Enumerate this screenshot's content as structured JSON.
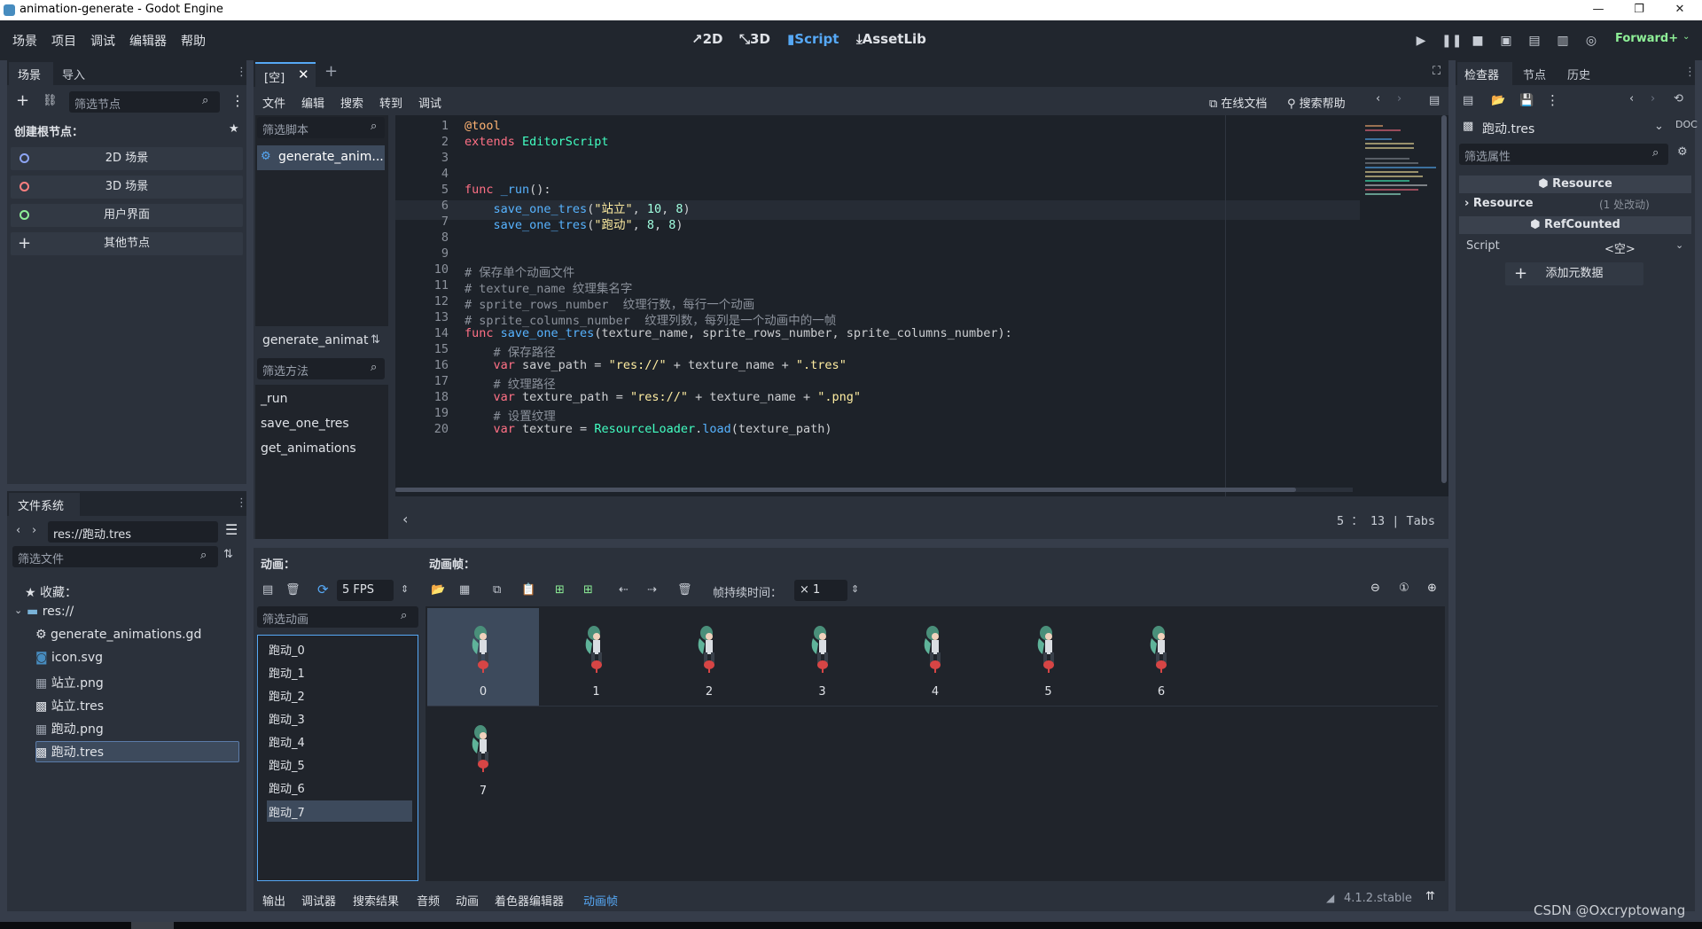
{
  "window": {
    "title": "animation-generate - Godot Engine",
    "minimize": "—",
    "restore": "❐",
    "close": "✕"
  },
  "menubar": {
    "items": [
      "场景",
      "项目",
      "调试",
      "编辑器",
      "帮助"
    ],
    "workspaces": [
      {
        "label": "2D",
        "icon": "↗"
      },
      {
        "label": "3D",
        "icon": "⤡"
      },
      {
        "label": "Script",
        "icon": "▮"
      },
      {
        "label": "AssetLib",
        "icon": "⤓"
      }
    ],
    "renderer": "Forward+"
  },
  "scene_dock": {
    "tabs": [
      "场景",
      "导入"
    ],
    "filter_placeholder": "筛选节点",
    "create_root_label": "创建根节点：",
    "root_buttons": [
      {
        "label": "2D 场景",
        "color": "#8da5f3"
      },
      {
        "label": "3D 场景",
        "color": "#fc7f7f"
      },
      {
        "label": "用户界面",
        "color": "#8eef97"
      },
      {
        "label": "其他节点",
        "color": "#e0e0e0"
      }
    ]
  },
  "filesystem": {
    "tab": "文件系统",
    "path": "res://跑动.tres",
    "filter_placeholder": "筛选文件",
    "favorites": "收藏：",
    "items": [
      {
        "label": "res://",
        "icon": "folder"
      },
      {
        "label": "generate_animations.gd",
        "icon": "gear"
      },
      {
        "label": "icon.svg",
        "icon": "image"
      },
      {
        "label": "站立.png",
        "icon": "image"
      },
      {
        "label": "站立.tres",
        "icon": "resource"
      },
      {
        "label": "跑动.png",
        "icon": "image"
      },
      {
        "label": "跑动.tres",
        "icon": "resource"
      }
    ]
  },
  "script_editor": {
    "tab": "[空]",
    "menu": [
      "文件",
      "编辑",
      "搜索",
      "转到",
      "调试"
    ],
    "online_docs": "在线文档",
    "search_help": "搜索帮助",
    "filter_scripts": "筛选脚本",
    "script_item": "generate_anim...",
    "methods_header": "generate_animat",
    "filter_methods": "筛选方法",
    "methods": [
      "_run",
      "save_one_tres",
      "get_animations"
    ],
    "status": "5 ：  13 | Tabs",
    "lines": [
      [
        {
          "c": "an",
          "t": "@tool"
        }
      ],
      [
        {
          "c": "kw",
          "t": "extends "
        },
        {
          "c": "ty",
          "t": "EditorScript"
        }
      ],
      [],
      [],
      [
        {
          "c": "kw",
          "t": "func "
        },
        {
          "c": "fn",
          "t": "_run"
        },
        {
          "c": "tx",
          "t": "():"
        }
      ],
      [
        {
          "c": "tx",
          "t": "    "
        },
        {
          "c": "fn",
          "t": "save_one_tres"
        },
        {
          "c": "tx",
          "t": "("
        },
        {
          "c": "st",
          "t": "\"站立\""
        },
        {
          "c": "tx",
          "t": ", "
        },
        {
          "c": "nm",
          "t": "10"
        },
        {
          "c": "tx",
          "t": ", "
        },
        {
          "c": "nm",
          "t": "8"
        },
        {
          "c": "tx",
          "t": ")"
        }
      ],
      [
        {
          "c": "tx",
          "t": "    "
        },
        {
          "c": "fn",
          "t": "save_one_tres"
        },
        {
          "c": "tx",
          "t": "("
        },
        {
          "c": "st",
          "t": "\"跑动\""
        },
        {
          "c": "tx",
          "t": ", "
        },
        {
          "c": "nm",
          "t": "8"
        },
        {
          "c": "tx",
          "t": ", "
        },
        {
          "c": "nm",
          "t": "8"
        },
        {
          "c": "tx",
          "t": ")"
        }
      ],
      [],
      [],
      [
        {
          "c": "cm",
          "t": "# 保存单个动画文件"
        }
      ],
      [
        {
          "c": "cm",
          "t": "# texture_name 纹理集名字"
        }
      ],
      [
        {
          "c": "cm",
          "t": "# sprite_rows_number  纹理行数，每行一个动画"
        }
      ],
      [
        {
          "c": "cm",
          "t": "# sprite_columns_number  纹理列数，每列是一个动画中的一帧"
        }
      ],
      [
        {
          "c": "kw",
          "t": "func "
        },
        {
          "c": "fn",
          "t": "save_one_tres"
        },
        {
          "c": "tx",
          "t": "(texture_name, sprite_rows_number, sprite_columns_number):"
        }
      ],
      [
        {
          "c": "tx",
          "t": "    "
        },
        {
          "c": "cm",
          "t": "# 保存路径"
        }
      ],
      [
        {
          "c": "tx",
          "t": "    "
        },
        {
          "c": "kw",
          "t": "var "
        },
        {
          "c": "tx",
          "t": "save_path = "
        },
        {
          "c": "st",
          "t": "\"res://\""
        },
        {
          "c": "tx",
          "t": " + texture_name + "
        },
        {
          "c": "st",
          "t": "\".tres\""
        }
      ],
      [
        {
          "c": "tx",
          "t": "    "
        },
        {
          "c": "cm",
          "t": "# 纹理路径"
        }
      ],
      [
        {
          "c": "tx",
          "t": "    "
        },
        {
          "c": "kw",
          "t": "var "
        },
        {
          "c": "tx",
          "t": "texture_path = "
        },
        {
          "c": "st",
          "t": "\"res://\""
        },
        {
          "c": "tx",
          "t": " + texture_name + "
        },
        {
          "c": "st",
          "t": "\".png\""
        }
      ],
      [
        {
          "c": "tx",
          "t": "    "
        },
        {
          "c": "cm",
          "t": "# 设置纹理"
        }
      ],
      [
        {
          "c": "tx",
          "t": "    "
        },
        {
          "c": "kw",
          "t": "var "
        },
        {
          "c": "tx",
          "t": "texture = "
        },
        {
          "c": "ty",
          "t": "ResourceLoader"
        },
        {
          "c": "tx",
          "t": "."
        },
        {
          "c": "fn",
          "t": "load"
        },
        {
          "c": "tx",
          "t": "(texture_path)"
        }
      ]
    ]
  },
  "anim_panel": {
    "animations_label": "动画：",
    "frames_label": "动画帧：",
    "fps": "5 FPS",
    "frame_duration_label": "帧持续时间：",
    "frame_duration": "× 1",
    "filter_animations": "筛选动画",
    "animations": [
      "跑动_0",
      "跑动_1",
      "跑动_2",
      "跑动_3",
      "跑动_4",
      "跑动_5",
      "跑动_6",
      "跑动_7"
    ],
    "frames": [
      "0",
      "1",
      "2",
      "3",
      "4",
      "5",
      "6",
      "7"
    ]
  },
  "bottom_tabs": [
    "输出",
    "调试器",
    "搜索结果",
    "音频",
    "动画",
    "着色器编辑器",
    "动画帧"
  ],
  "version": "4.1.2.stable",
  "inspector": {
    "tabs": [
      "检查器",
      "节点",
      "历史"
    ],
    "resource_name": "跑动.tres",
    "filter_placeholder": "筛选属性",
    "section1": "Resource",
    "resource_row": "Resource",
    "resource_changes": "(1 处改动)",
    "section2": "RefCounted",
    "script_label": "Script",
    "script_value": "<空>",
    "add_metadata": "添加元数据"
  },
  "watermark": "CSDN @Oxcryptowang"
}
